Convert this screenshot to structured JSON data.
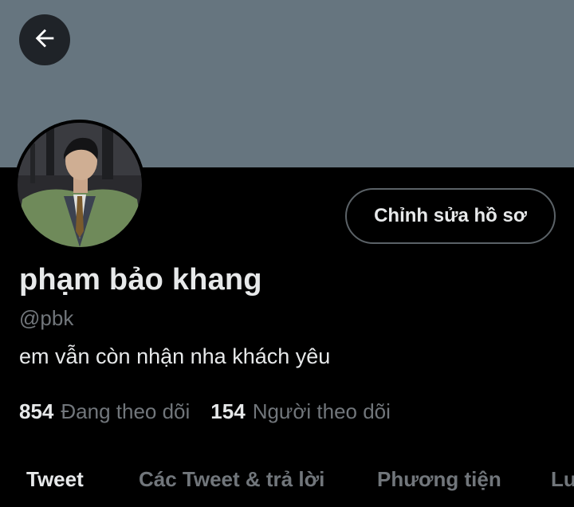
{
  "profile": {
    "display_name": "phạm bảo khang",
    "handle": "@pbk",
    "bio": "em vẫn còn nhận nha khách yêu"
  },
  "actions": {
    "edit_profile_label": "Chỉnh sửa hồ sơ"
  },
  "stats": {
    "following_count": "854",
    "following_label": "Đang theo dõi",
    "followers_count": "154",
    "followers_label": "Người theo dõi"
  },
  "tabs": [
    {
      "label": "Tweet",
      "active": true
    },
    {
      "label": "Các Tweet & trả lời",
      "active": false
    },
    {
      "label": "Phương tiện",
      "active": false
    },
    {
      "label": "Lư",
      "active": false
    }
  ],
  "icons": {
    "back": "arrow-left-icon"
  },
  "colors": {
    "banner": "#66757f",
    "background": "#000000",
    "primary_text": "#e7e9ea",
    "secondary_text": "#71767b"
  }
}
